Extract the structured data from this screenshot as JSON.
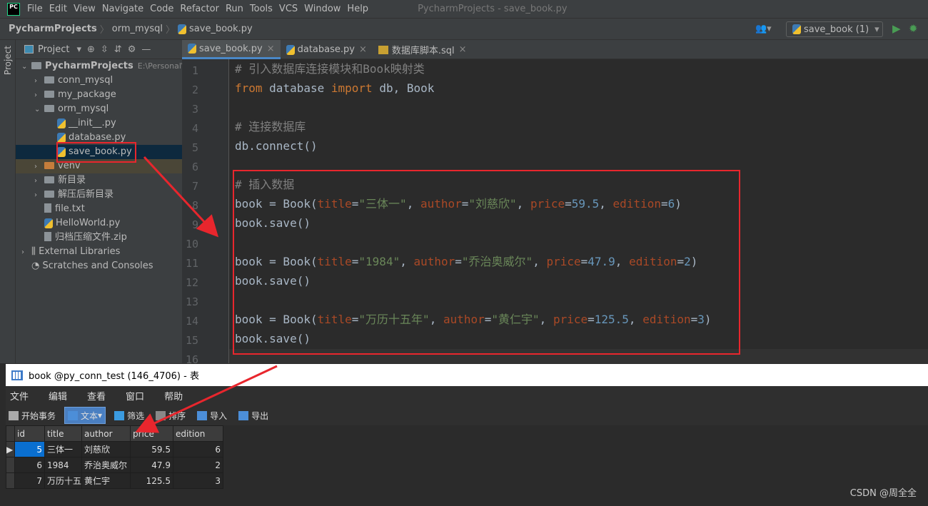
{
  "app": {
    "logo": "PC",
    "menu": [
      "File",
      "Edit",
      "View",
      "Navigate",
      "Code",
      "Refactor",
      "Run",
      "Tools",
      "VCS",
      "Window",
      "Help"
    ],
    "window_title": "PycharmProjects - save_book.py"
  },
  "breadcrumb": [
    "PycharmProjects",
    "orm_mysql",
    "save_book.py"
  ],
  "run_config": "save_book (1)",
  "stripe_label": "Project",
  "project_panel": {
    "title": "Project",
    "items": [
      {
        "label": "PycharmProjects",
        "extra": "E:\\Personal\\Py",
        "type": "folder",
        "depth": 0,
        "expanded": true
      },
      {
        "label": "conn_mysql",
        "type": "folder",
        "depth": 1,
        "expanded": false
      },
      {
        "label": "my_package",
        "type": "folder",
        "depth": 1,
        "expanded": false
      },
      {
        "label": "orm_mysql",
        "type": "folder",
        "depth": 1,
        "expanded": true
      },
      {
        "label": "__init__.py",
        "type": "py",
        "depth": 2
      },
      {
        "label": "database.py",
        "type": "py",
        "depth": 2
      },
      {
        "label": "save_book.py",
        "type": "py",
        "depth": 2,
        "selected": true
      },
      {
        "label": "venv",
        "type": "folder-orange",
        "depth": 1,
        "expanded": false
      },
      {
        "label": "新目录",
        "type": "folder",
        "depth": 1,
        "expanded": false
      },
      {
        "label": "解压后新目录",
        "type": "folder",
        "depth": 1,
        "expanded": false
      },
      {
        "label": "file.txt",
        "type": "file",
        "depth": 1
      },
      {
        "label": "HelloWorld.py",
        "type": "py",
        "depth": 1
      },
      {
        "label": "归档压缩文件.zip",
        "type": "file",
        "depth": 1
      },
      {
        "label": "External Libraries",
        "type": "lib",
        "depth": 0,
        "expanded": false
      },
      {
        "label": "Scratches and Consoles",
        "type": "scratch",
        "depth": 0
      }
    ]
  },
  "tabs": [
    {
      "label": "save_book.py",
      "active": true
    },
    {
      "label": "database.py"
    },
    {
      "label": "数据库脚本.sql"
    }
  ],
  "code_lines": [
    [
      [
        "comment",
        "# 引入数据库连接模块和Book映射类"
      ]
    ],
    [
      [
        "kw",
        "from "
      ],
      [
        "d",
        "database "
      ],
      [
        "kw",
        "import "
      ],
      [
        "d",
        "db, Book"
      ]
    ],
    [],
    [
      [
        "comment",
        "# 连接数据库"
      ]
    ],
    [
      [
        "d",
        "db.connect()"
      ]
    ],
    [],
    [
      [
        "comment",
        "# 插入数据"
      ]
    ],
    [
      [
        "d",
        "book = Book("
      ],
      [
        "param",
        "title"
      ],
      [
        "d",
        "="
      ],
      [
        "str",
        "\"三体一\""
      ],
      [
        "d",
        ", "
      ],
      [
        "param",
        "author"
      ],
      [
        "d",
        "="
      ],
      [
        "str",
        "\"刘慈欣\""
      ],
      [
        "d",
        ", "
      ],
      [
        "param",
        "price"
      ],
      [
        "d",
        "="
      ],
      [
        "num",
        "59.5"
      ],
      [
        "d",
        ", "
      ],
      [
        "param",
        "edition"
      ],
      [
        "d",
        "="
      ],
      [
        "num",
        "6"
      ],
      [
        "d",
        ")"
      ]
    ],
    [
      [
        "d",
        "book.save()"
      ]
    ],
    [],
    [
      [
        "d",
        "book = Book("
      ],
      [
        "param",
        "title"
      ],
      [
        "d",
        "="
      ],
      [
        "str",
        "\"1984\""
      ],
      [
        "d",
        ", "
      ],
      [
        "param",
        "author"
      ],
      [
        "d",
        "="
      ],
      [
        "str",
        "\"乔治奥威尔\""
      ],
      [
        "d",
        ", "
      ],
      [
        "param",
        "price"
      ],
      [
        "d",
        "="
      ],
      [
        "num",
        "47.9"
      ],
      [
        "d",
        ", "
      ],
      [
        "param",
        "edition"
      ],
      [
        "d",
        "="
      ],
      [
        "num",
        "2"
      ],
      [
        "d",
        ")"
      ]
    ],
    [
      [
        "d",
        "book.save()"
      ]
    ],
    [],
    [
      [
        "d",
        "book = Book("
      ],
      [
        "param",
        "title"
      ],
      [
        "d",
        "="
      ],
      [
        "str",
        "\"万历十五年\""
      ],
      [
        "d",
        ", "
      ],
      [
        "param",
        "author"
      ],
      [
        "d",
        "="
      ],
      [
        "str",
        "\"黄仁宇\""
      ],
      [
        "d",
        ", "
      ],
      [
        "param",
        "price"
      ],
      [
        "d",
        "="
      ],
      [
        "num",
        "125.5"
      ],
      [
        "d",
        ", "
      ],
      [
        "param",
        "edition"
      ],
      [
        "d",
        "="
      ],
      [
        "num",
        "3"
      ],
      [
        "d",
        ")"
      ]
    ],
    [
      [
        "d",
        "book.save()"
      ]
    ],
    []
  ],
  "db_window": {
    "title": "book @py_conn_test (146_4706) - 表",
    "menu": [
      "文件",
      "编辑",
      "查看",
      "窗口",
      "帮助"
    ],
    "toolbar": [
      "开始事务",
      "文本",
      "筛选",
      "排序",
      "导入",
      "导出"
    ],
    "columns": [
      "id",
      "title",
      "author",
      "price",
      "edition"
    ],
    "rows": [
      [
        "5",
        "三体一",
        "刘慈欣",
        "59.5",
        "6"
      ],
      [
        "6",
        "1984",
        "乔治奥威尔",
        "47.9",
        "2"
      ],
      [
        "7",
        "万历十五年",
        "黄仁宇",
        "125.5",
        "3"
      ]
    ]
  },
  "watermark": "CSDN @周全全",
  "colors": {
    "annotation": "#e8262d",
    "keyword": "#cc7832",
    "string": "#6a8759",
    "number": "#6897bb",
    "param": "#aa4926",
    "comment": "#808080"
  }
}
